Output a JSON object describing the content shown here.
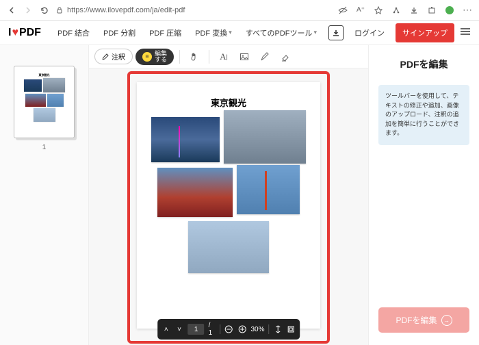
{
  "browser": {
    "url": "https://www.ilovepdf.com/ja/edit-pdf"
  },
  "logo": {
    "prefix": "I",
    "suffix": "PDF"
  },
  "nav": {
    "merge": "PDF 結合",
    "split": "PDF 分割",
    "compress": "PDF 圧縮",
    "convert": "PDF 変換",
    "all": "すべてのPDFツール",
    "login": "ログイン",
    "signup": "サインアップ"
  },
  "toolbar": {
    "annotate": "注釈",
    "edit_line1": "編集",
    "edit_line2": "する"
  },
  "page": {
    "title": "東京観光",
    "thumb_num": "1"
  },
  "controls": {
    "page_current": "1",
    "page_total": "/ 1",
    "zoom": "30%"
  },
  "right": {
    "title": "PDFを編集",
    "tip": "ツールバーを使用して、テキストの修正や追加、画像のアップロード、注釈の追加を簡単に行うことができます。",
    "action": "PDFを編集"
  }
}
